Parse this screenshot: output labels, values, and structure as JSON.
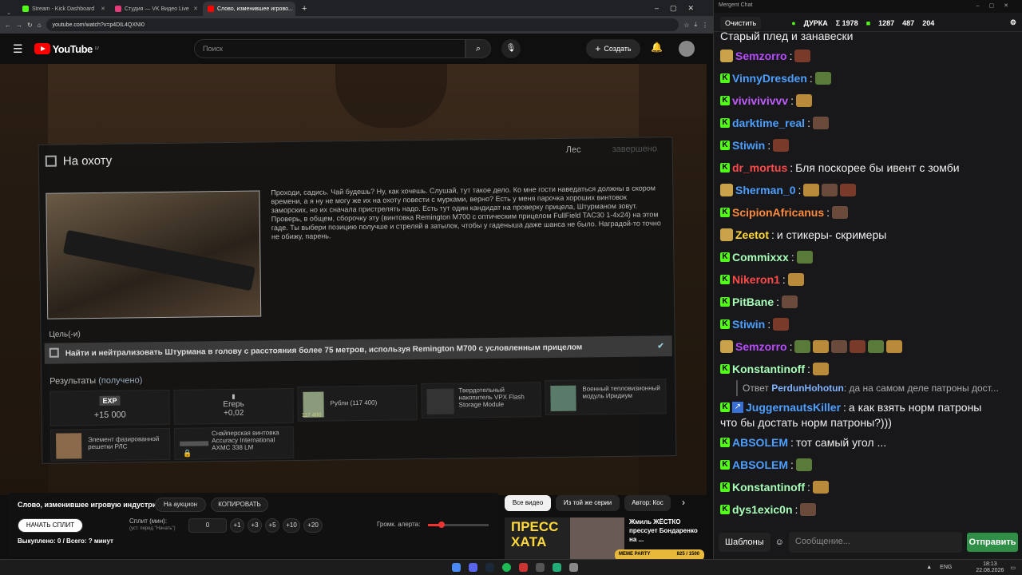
{
  "browser": {
    "tabs": [
      {
        "label": "Stream - Kick Dashboard",
        "color": "#53fc18"
      },
      {
        "label": "Студия — VK Видео Live",
        "color": "#e63b7a"
      },
      {
        "label": "Слово, изменившее игрово...",
        "color": "#ff0000"
      }
    ],
    "url": "youtube.com/watch?v=p4DIL4QXNI0"
  },
  "youtube": {
    "logo": "YouTube",
    "logo_region": "LV",
    "search_placeholder": "Поиск",
    "create_label": "Создать"
  },
  "quest": {
    "title": "На охоту",
    "location": "Лес",
    "status": "завершено",
    "description": "Проходи, садись. Чай будешь? Ну, как хочешь. Слушай, тут такое дело. Ко мне гости наведаться должны в скором времени, а я ну не могу же их на охоту повести с мурками, верно? Есть у меня парочка хороших винтовок заморских, но их сначала пристрелять надо. Есть тут один кандидат на проверку прицела, Штурманом зовут. Проверь, в общем, сборочку эту (винтовка Remington M700 с оптическим прицелом FullField TAC30 1-4x24) на этом гаде. Ты выбери позицию получше и стреляй в затылок, чтобы у гаденыша даже шанса не было. Наградой-то точно не обижу, парень.",
    "goal_label": "Цель(-и)",
    "objective": "Найти и нейтрализовать Штурмана в голову с расстояния более 75 метров, используя Remington M700 с условленным прицелом",
    "results_label": "Результаты",
    "results_status": "(получено)",
    "rewards": {
      "exp_badge": "EXP",
      "exp_value": "+15 000",
      "rep_name": "Егерь",
      "rep_value": "+0,02",
      "money_amount": "117 400",
      "money_label": "Рубли (117 400)",
      "item1": "Твердотельный накопитель VPX Flash Storage Module",
      "item2": "Военный тепловизионный модуль Иридиум",
      "item3": "Элемент фазированной решетки РЛС",
      "item4": "Снайперская винтовка Accuracy International AXMC 338 LM"
    }
  },
  "below": {
    "video_title": "Слово, изменившее игровую индустрию",
    "auction_btn": "На аукцион",
    "copy_btn": "КОПИРОВАТЬ",
    "start_split_btn": "НАЧАТЬ СПЛИТ",
    "split_label": "Сплит (мин):",
    "split_hint": "(уст. перед \"Начать\")",
    "split_value": "0",
    "steps": [
      "+1",
      "+3",
      "+5",
      "+10",
      "+20"
    ],
    "alert_volume": "Громк. алерта:",
    "bought": "Выкуплено: 0 / Всего: ? минут"
  },
  "side": {
    "chips": [
      "Все видео",
      "Из той же серии",
      "Автор: Кос"
    ],
    "rec_title": "Жмиль ЖЁСТКО прессует Бондаренко на ...",
    "thumb_text": "ПРЕСС ХАТА",
    "meme_party": "MEME PARTY",
    "progress": "825 / 1500"
  },
  "chat": {
    "window_title": "Mergent Chat",
    "clear_label": "Очистить",
    "channel": "ДУРКА",
    "stats": [
      "Σ 1978",
      "1287",
      "487",
      "204"
    ],
    "top_line": "Старый плед и занавески",
    "messages": [
      {
        "user": "Semzorro",
        "color": "#b84cff",
        "text": "",
        "emotes": 1,
        "badge": "face"
      },
      {
        "user": "VinnyDresden",
        "color": "#4d9fff",
        "text": "",
        "emotes": 1,
        "badge": "k"
      },
      {
        "user": "vivivivivvv",
        "color": "#c15cff",
        "text": "",
        "emotes": 1,
        "badge": "k"
      },
      {
        "user": "darktime_real",
        "color": "#4d9fff",
        "text": "",
        "emotes": 1,
        "badge": "k"
      },
      {
        "user": "Stiwin",
        "color": "#4d9fff",
        "text": "",
        "emotes": 1,
        "badge": "k"
      },
      {
        "user": "dr_mortus",
        "color": "#ff4a4a",
        "text": "Бля поскорее бы ивент с зомби",
        "emotes": 0,
        "badge": "k"
      },
      {
        "user": "Sherman_0",
        "color": "#4d9fff",
        "text": "",
        "emotes": 3,
        "badge": "face"
      },
      {
        "user": "ScipionAfricanus",
        "color": "#ff8a3a",
        "text": "",
        "emotes": 1,
        "badge": "k"
      },
      {
        "user": "Zeetot",
        "color": "#ffd83a",
        "text": "и стикеры- скримеры",
        "emotes": 0,
        "badge": "face"
      },
      {
        "user": "Commixxx",
        "color": "#a8ffb8",
        "text": "",
        "emotes": 1,
        "badge": "k"
      },
      {
        "user": "Nikeron1",
        "color": "#ff4a4a",
        "text": "",
        "emotes": 1,
        "badge": "k"
      },
      {
        "user": "PitBane",
        "color": "#a8ffb8",
        "text": "",
        "emotes": 1,
        "badge": "k"
      },
      {
        "user": "Stiwin",
        "color": "#4d9fff",
        "text": "",
        "emotes": 1,
        "badge": "k"
      },
      {
        "user": "Semzorro",
        "color": "#b84cff",
        "text": "",
        "emotes": 6,
        "badge": "face"
      },
      {
        "user": "Konstantinoff",
        "color": "#a8ffb8",
        "text": "",
        "emotes": 1,
        "badge": "k"
      }
    ],
    "reply_prefix": "Ответ",
    "reply_user": "PerdunHohotun",
    "reply_text": ": да на самом деле патроны дост...",
    "reply_msg_user": "JuggernautsKiller",
    "reply_msg_text": "а как взять норм патроны",
    "reply_msg_text2": "что бы достать норм патроны?)))",
    "tail": [
      {
        "user": "ABSOLEM",
        "color": "#4d9fff",
        "text": "тот самый угол ...",
        "emotes": 0
      },
      {
        "user": "ABSOLEM",
        "color": "#4d9fff",
        "text": "",
        "emotes": 1
      },
      {
        "user": "Konstantinoff",
        "color": "#a8ffb8",
        "text": "",
        "emotes": 1
      },
      {
        "user": "dys1exic0n",
        "color": "#a8ffb8",
        "text": "",
        "emotes": 1
      }
    ],
    "templates_label": "Шаблоны",
    "input_placeholder": "Сообщение...",
    "send_label": "Отправить"
  },
  "taskbar": {
    "lang": "ENG",
    "time": "18:13",
    "date": "22.08.2026"
  }
}
